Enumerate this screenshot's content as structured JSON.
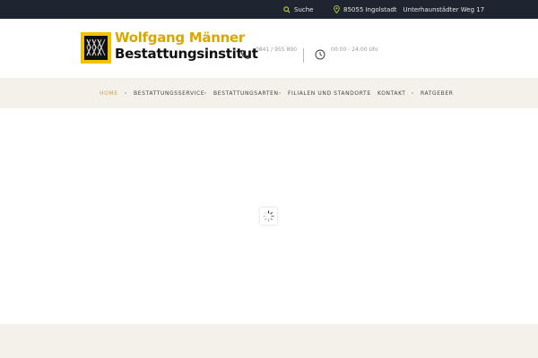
{
  "topbar": {
    "search_label": "Suche",
    "city": "85055 Ingolstadt",
    "street": "Unterhaunstädter Weg 17"
  },
  "header": {
    "brand_line1": "Wolfgang Männer",
    "brand_line2": "Bestattungsinstitut",
    "phone": "0841 / 955 890",
    "hours": "00:00 - 24:00 Uhr"
  },
  "nav": {
    "items": [
      {
        "label": "HOME",
        "active": true
      },
      {
        "label": "BESTATTUNGSSERVICE"
      },
      {
        "label": "BESTATTUNGSARTEN"
      },
      {
        "label": "FILIALEN UND STANDORTE"
      },
      {
        "label": "KONTAKT"
      },
      {
        "label": "RATGEBER"
      }
    ]
  },
  "colors": {
    "topbar_bg": "#1e2430",
    "accent": "#c8a34d",
    "logo_yellow": "#f2c200",
    "nav_bg": "#f4f1ea"
  },
  "icons": {
    "search": "search-icon",
    "location": "map-pin-icon",
    "phone": "phone-icon",
    "clock": "clock-icon",
    "loader": "spinner-icon"
  }
}
